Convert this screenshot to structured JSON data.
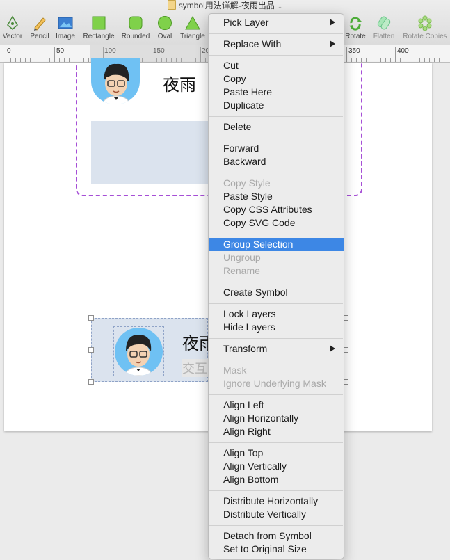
{
  "document": {
    "title": "symbol用法详解-夜雨出品"
  },
  "toolbar": {
    "tools": [
      {
        "label": "Vector",
        "icon": "vector-pen-icon"
      },
      {
        "label": "Pencil",
        "icon": "pencil-icon"
      },
      {
        "label": "Image",
        "icon": "image-icon"
      },
      {
        "label": "Rectangle",
        "icon": "rectangle-icon"
      },
      {
        "label": "Rounded",
        "icon": "rounded-rectangle-icon"
      },
      {
        "label": "Oval",
        "icon": "oval-icon"
      },
      {
        "label": "Triangle",
        "icon": "triangle-icon"
      },
      {
        "label": "Rotate",
        "icon": "rotate-icon"
      },
      {
        "label": "Flatten",
        "icon": "flatten-icon"
      },
      {
        "label": "Rotate Copies",
        "icon": "rotate-copies-icon"
      }
    ]
  },
  "ruler": {
    "labels": [
      "0",
      "50",
      "100",
      "150",
      "20",
      "350",
      "400"
    ]
  },
  "canvas": {
    "symbol_top": {
      "name": "夜雨"
    },
    "symbol_bottom": {
      "name": "夜雨",
      "subtitle": "交互"
    }
  },
  "context_menu": {
    "items": [
      {
        "label": "Pick Layer",
        "submenu": true
      },
      {
        "label": "Replace With",
        "submenu": true
      },
      {
        "label": "Cut"
      },
      {
        "label": "Copy"
      },
      {
        "label": "Paste Here"
      },
      {
        "label": "Duplicate"
      },
      {
        "label": "Delete"
      },
      {
        "label": "Forward"
      },
      {
        "label": "Backward"
      },
      {
        "label": "Copy Style",
        "disabled": true
      },
      {
        "label": "Paste Style"
      },
      {
        "label": "Copy CSS Attributes"
      },
      {
        "label": "Copy SVG Code"
      },
      {
        "label": "Group Selection",
        "highlighted": true
      },
      {
        "label": "Ungroup",
        "disabled": true
      },
      {
        "label": "Rename",
        "disabled": true
      },
      {
        "label": "Create Symbol"
      },
      {
        "label": "Lock Layers"
      },
      {
        "label": "Hide Layers"
      },
      {
        "label": "Transform",
        "submenu": true
      },
      {
        "label": "Mask",
        "disabled": true
      },
      {
        "label": "Ignore Underlying Mask",
        "disabled": true
      },
      {
        "label": "Align Left"
      },
      {
        "label": "Align Horizontally"
      },
      {
        "label": "Align Right"
      },
      {
        "label": "Align Top"
      },
      {
        "label": "Align Vertically"
      },
      {
        "label": "Align Bottom"
      },
      {
        "label": "Distribute Horizontally"
      },
      {
        "label": "Distribute Vertically"
      },
      {
        "label": "Detach from Symbol"
      },
      {
        "label": "Set to Original Size"
      }
    ]
  },
  "colors": {
    "menu_highlight": "#3d87e5",
    "selection_dashed": "#a64fd6",
    "avatar_bg": "#6fc1f3",
    "placeholder_fill": "#dbe3ee"
  }
}
